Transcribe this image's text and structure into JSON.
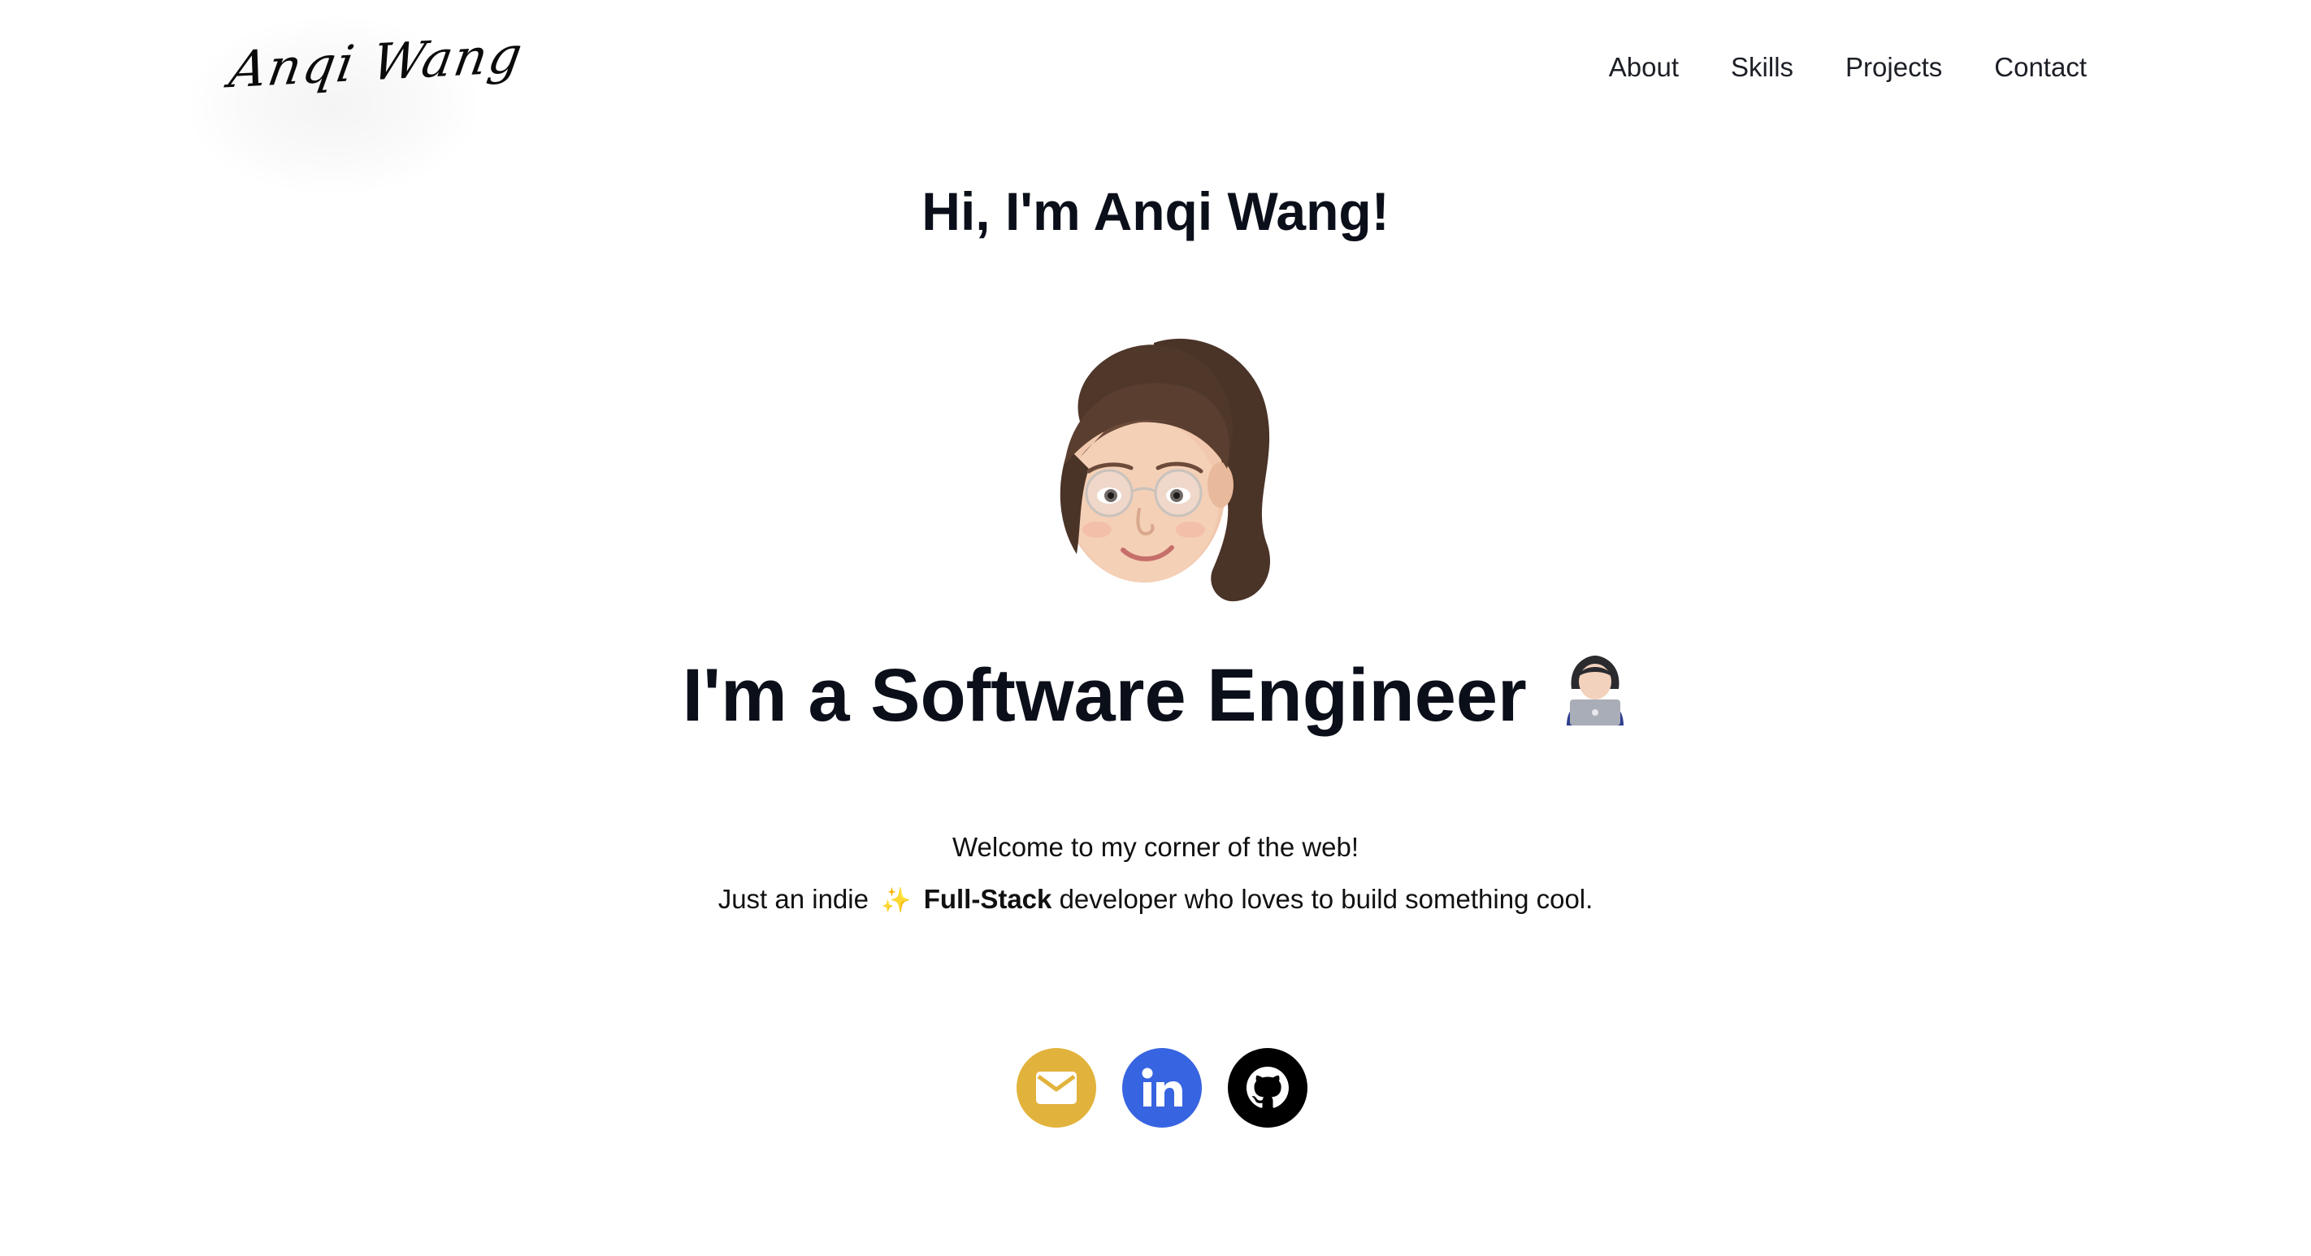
{
  "header": {
    "logo_text": "Anqi Wang",
    "nav": [
      {
        "label": "About"
      },
      {
        "label": "Skills"
      },
      {
        "label": "Projects"
      },
      {
        "label": "Contact"
      }
    ]
  },
  "hero": {
    "greeting": "Hi, I'm Anqi Wang!",
    "avatar_icon": "memoji-avatar",
    "role_text": "I'm a Software Engineer",
    "role_emoji_icon": "woman-technologist-icon",
    "intro_line1": "Welcome to my corner of the web!",
    "intro_line2_prefix": "Just an indie",
    "intro_sparkle": "✨",
    "intro_line2_bold": "Full-Stack",
    "intro_line2_suffix": "developer who loves to build something cool."
  },
  "social": [
    {
      "icon": "envelope-icon",
      "color": "#E2B33C"
    },
    {
      "icon": "linkedin-icon",
      "color": "#3764E0"
    },
    {
      "icon": "github-icon",
      "color": "#000000"
    }
  ],
  "colors": {
    "text": "#0B0F1A",
    "background": "#FFFFFF"
  }
}
